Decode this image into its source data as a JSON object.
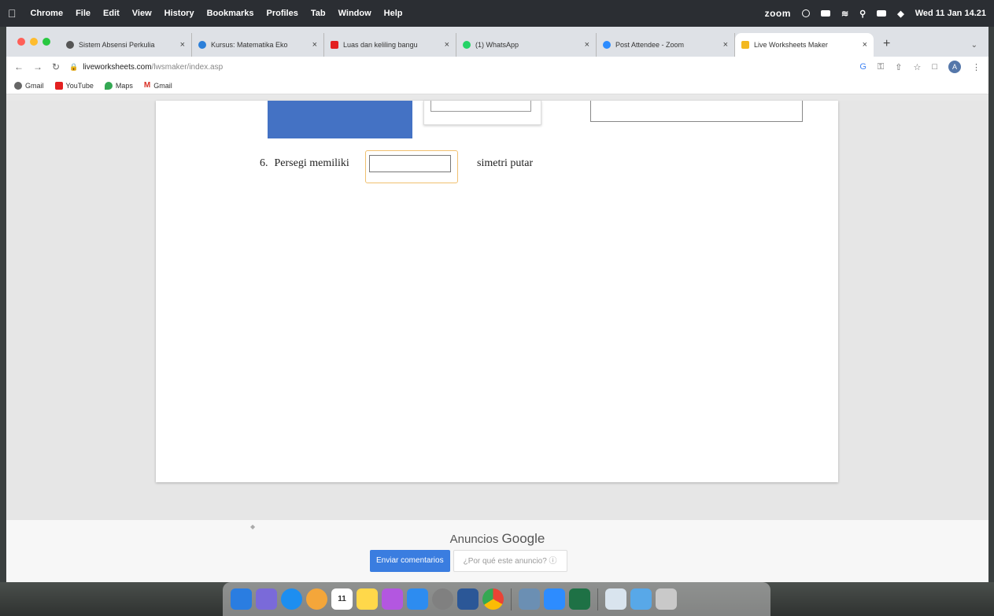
{
  "menubar": {
    "apple": "",
    "items": [
      "Chrome",
      "File",
      "Edit",
      "View",
      "History",
      "Bookmarks",
      "Profiles",
      "Tab",
      "Window",
      "Help"
    ],
    "zoom": "zoom",
    "datetime": "Wed 11 Jan 14.21"
  },
  "tabs": [
    {
      "title": "Sistem Absensi Perkulia",
      "color": "#555555"
    },
    {
      "title": "Kursus: Matematika Eko",
      "color": "#2b7fd9"
    },
    {
      "title": "Luas dan keliling bangu",
      "color": "#e32020"
    },
    {
      "title": "(1) WhatsApp",
      "color": "#25d366"
    },
    {
      "title": "Post Attendee - Zoom",
      "color": "#2d8cff"
    },
    {
      "title": "Live Worksheets Maker",
      "color": "#f3b81e"
    }
  ],
  "toolbar": {
    "url_host": "liveworksheets.com",
    "url_path": "/lwsmaker/index.asp",
    "avatar": "A"
  },
  "bookmarks": [
    {
      "label": "Gmail",
      "color": "#666666"
    },
    {
      "label": "YouTube",
      "color": "#e32020"
    },
    {
      "label": "Maps",
      "color": "#34a853"
    },
    {
      "label": "Gmail",
      "color": "#d93025"
    }
  ],
  "worksheet": {
    "q6_number": "6.",
    "q6_text": "Persegi memiliki",
    "q6_answer": "",
    "q6_suffix": "simetri putar"
  },
  "ads": {
    "title_prefix": "Anuncios",
    "title_brand": "Google",
    "send_feedback": "Enviar comentarios",
    "why_ad": "¿Por qué este anuncio? ⓘ"
  },
  "dock": {
    "calendar_day": "11",
    "items": [
      {
        "name": "finder",
        "color": "#2a7de1"
      },
      {
        "name": "launchpad",
        "color": "#7a6ad9"
      },
      {
        "name": "safari",
        "color": "#1d8ef0"
      },
      {
        "name": "photos",
        "color": "#f4a63a"
      },
      {
        "name": "calendar",
        "color": "#ffffff"
      },
      {
        "name": "notes",
        "color": "#ffd84a"
      },
      {
        "name": "podcasts",
        "color": "#b357e0"
      },
      {
        "name": "app-store",
        "color": "#2d8cf0"
      },
      {
        "name": "system-preferences",
        "color": "#808080"
      },
      {
        "name": "word",
        "color": "#2b5797"
      },
      {
        "name": "chrome",
        "color": "#e0e0e0"
      },
      {
        "name": "preview",
        "color": "#6b8fb3"
      },
      {
        "name": "zoom",
        "color": "#2d8cff"
      },
      {
        "name": "excel",
        "color": "#1e7145"
      },
      {
        "name": "downloads",
        "color": "#d9e4ee"
      },
      {
        "name": "folder",
        "color": "#58a8e8"
      },
      {
        "name": "trash",
        "color": "#c9c9c9"
      }
    ]
  }
}
